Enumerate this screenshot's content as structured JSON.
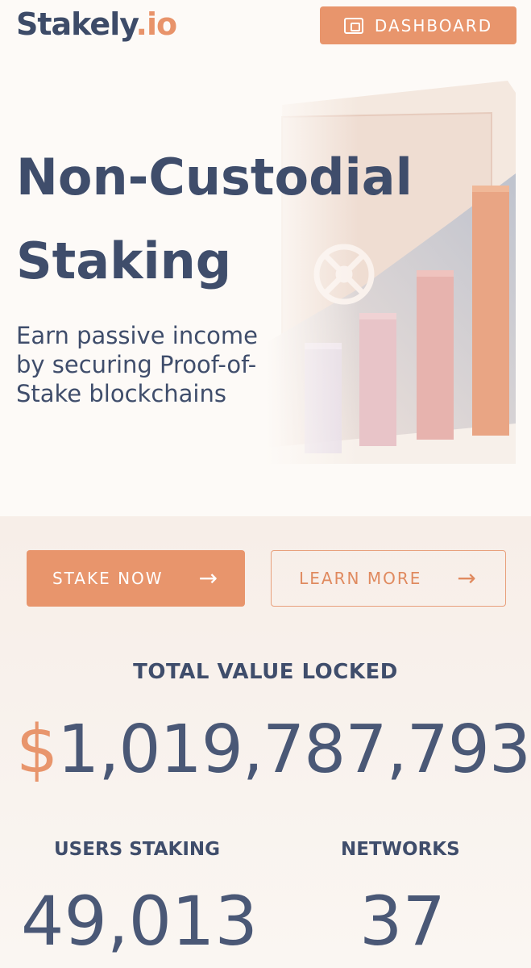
{
  "header": {
    "logo_brand": "Stakely",
    "logo_tld": ".io",
    "dashboard_label": "DASHBOARD"
  },
  "hero": {
    "title_line1": "Non-Custodial",
    "title_line2": "Staking",
    "subtitle": "Earn passive income by securing Proof-of-Stake blockchains"
  },
  "actions": {
    "stake_now_label": "STAKE NOW",
    "learn_more_label": "LEARN MORE"
  },
  "stats": {
    "tvl_label": "TOTAL VALUE LOCKED",
    "tvl_currency": "$",
    "tvl_amount": "1,019,787,793",
    "users_label": "USERS STAKING",
    "users_value": "49,013",
    "networks_label": "NETWORKS",
    "networks_value": "37"
  },
  "colors": {
    "accent": "#e8956c",
    "text": "#3f4d6b"
  },
  "icons": {
    "dashboard": "wallet-icon",
    "buttons": "arrow-right-icon"
  }
}
